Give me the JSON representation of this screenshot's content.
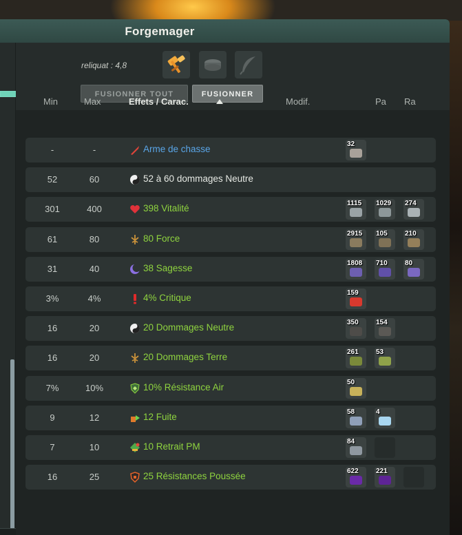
{
  "window": {
    "title": "Forgemager"
  },
  "reliquat": "reliquat : 4,8",
  "progress": {
    "fraction": 1.0
  },
  "slots": [
    {
      "icon": "golden-hammer-icon",
      "filled": true
    },
    {
      "icon": "rune-slot-icon",
      "filled": false
    },
    {
      "icon": "feather-slot-icon",
      "filled": false
    }
  ],
  "buttons": {
    "fuse_all": "FUSIONNER TOUT",
    "fuse": "FUSIONNER"
  },
  "table": {
    "headers": {
      "min": "Min",
      "max": "Max",
      "effects": "Effets / Carac.",
      "modif": "Modif.",
      "pa": "Pa",
      "ra": "Ra"
    },
    "rows": [
      {
        "min": "-",
        "max": "-",
        "icon": "weapon-icon",
        "value": "",
        "label": "Arme de chasse",
        "style": "blue",
        "runes": [
          {
            "qty": "32",
            "color": "#a9a29a"
          }
        ]
      },
      {
        "min": "52",
        "max": "60",
        "icon": "neutral-yin-yang-icon",
        "value": "52 à 60",
        "label": "dommages Neutre",
        "style": "white",
        "runes": []
      },
      {
        "min": "301",
        "max": "400",
        "icon": "heart-icon",
        "value": "398",
        "label": "Vitalité",
        "style": "green",
        "runes": [
          {
            "qty": "1115",
            "color": "#9aa3a6"
          },
          {
            "qty": "1029",
            "color": "#8d9799"
          },
          {
            "qty": "274",
            "color": "#aab2b5"
          }
        ]
      },
      {
        "min": "61",
        "max": "80",
        "icon": "earth-icon",
        "value": "80",
        "label": "Force",
        "style": "green",
        "runes": [
          {
            "qty": "2915",
            "color": "#8a7b5e"
          },
          {
            "qty": "105",
            "color": "#7f7156"
          },
          {
            "qty": "210",
            "color": "#947f5a"
          }
        ]
      },
      {
        "min": "31",
        "max": "40",
        "icon": "moon-icon",
        "value": "38",
        "label": "Sagesse",
        "style": "green",
        "runes": [
          {
            "qty": "1808",
            "color": "#6d5fb1"
          },
          {
            "qty": "710",
            "color": "#6050a8"
          },
          {
            "qty": "80",
            "color": "#7a68c0"
          }
        ]
      },
      {
        "min": "3%",
        "max": "4%",
        "icon": "critical-icon",
        "value": "4%",
        "label": "Critique",
        "style": "green",
        "runes": [
          {
            "qty": "159",
            "color": "#d8392e"
          }
        ]
      },
      {
        "min": "16",
        "max": "20",
        "icon": "neutral-yin-yang-icon",
        "value": "20",
        "label": "Dommages Neutre",
        "style": "green",
        "runes": [
          {
            "qty": "350",
            "color": "#4e4c49"
          },
          {
            "qty": "154",
            "color": "#5b5955"
          }
        ]
      },
      {
        "min": "16",
        "max": "20",
        "icon": "earth-icon",
        "value": "20",
        "label": "Dommages Terre",
        "style": "green",
        "runes": [
          {
            "qty": "261",
            "color": "#7a8a3a"
          },
          {
            "qty": "53",
            "color": "#8fa24a"
          }
        ]
      },
      {
        "min": "7%",
        "max": "10%",
        "icon": "shield-air-icon",
        "value": "10%",
        "label": "Résistance Air",
        "style": "green",
        "runes": [
          {
            "qty": "50",
            "color": "#c7b15a"
          }
        ]
      },
      {
        "min": "9",
        "max": "12",
        "icon": "flee-icon",
        "value": "12",
        "label": "Fuite",
        "style": "green",
        "runes": [
          {
            "qty": "58",
            "color": "#8f9fb8"
          },
          {
            "qty": "4",
            "color": "#a8d6f0"
          }
        ]
      },
      {
        "min": "7",
        "max": "10",
        "icon": "mp-removal-icon",
        "value": "10",
        "label": "Retrait PM",
        "style": "green",
        "runes": [
          {
            "qty": "84",
            "color": "#8f98a0"
          },
          {
            "qty": "",
            "color": ""
          }
        ]
      },
      {
        "min": "16",
        "max": "25",
        "icon": "pushback-shield-icon",
        "value": "25",
        "label": "Résistances Poussée",
        "style": "green",
        "runes": [
          {
            "qty": "622",
            "color": "#6a2aa8"
          },
          {
            "qty": "221",
            "color": "#5e2496"
          },
          {
            "qty": "",
            "color": ""
          }
        ]
      }
    ]
  }
}
